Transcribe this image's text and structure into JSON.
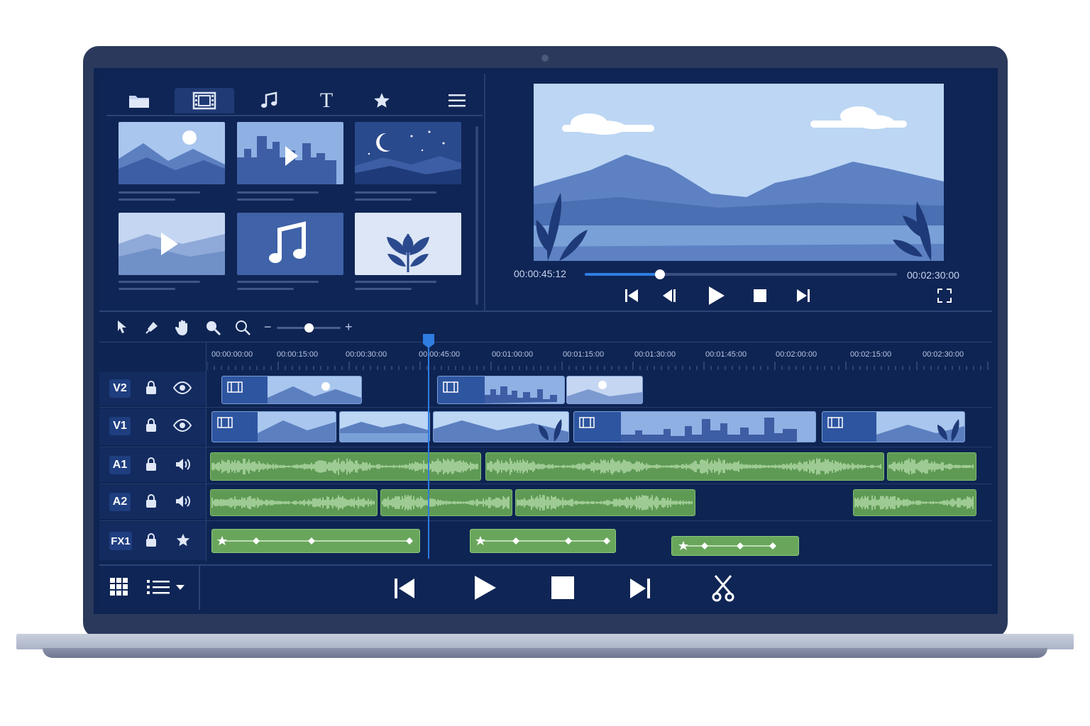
{
  "colors": {
    "screen": "#0e2452",
    "accent": "#2f7de1",
    "clip": "#4f74b5",
    "audio": "#5f9a55",
    "fx": "#69a65c"
  },
  "media_tabs": [
    {
      "icon": "folder-icon",
      "active": false
    },
    {
      "icon": "film-icon",
      "active": true
    },
    {
      "icon": "music-note-icon",
      "active": false
    },
    {
      "icon": "text-icon",
      "active": false,
      "glyph": "T"
    },
    {
      "icon": "star-icon",
      "active": false
    }
  ],
  "media_items": [
    {
      "icon": "landscape-sun-thumbnail"
    },
    {
      "icon": "city-video-thumbnail"
    },
    {
      "icon": "night-moon-thumbnail"
    },
    {
      "icon": "hills-video-thumbnail"
    },
    {
      "icon": "music-thumbnail"
    },
    {
      "icon": "leaf-thumbnail"
    }
  ],
  "preview": {
    "current_time": "00:00:45:12",
    "total_time": "00:02:30:00",
    "progress": 0.24
  },
  "timeline": {
    "zoom_level": 0.5,
    "ruler": [
      "00:00:00:00",
      "00:00:15:00",
      "00:00:30:00",
      "00:00:45:00",
      "00:01:00:00",
      "00:01:15:00",
      "00:01:30:00",
      "00:01:45:00",
      "00:02:00:00",
      "00:02:15:00",
      "00:02:30:00"
    ],
    "playhead_time": "00:00:45:12",
    "tracks": [
      {
        "label": "V2",
        "type": "video"
      },
      {
        "label": "V1",
        "type": "video"
      },
      {
        "label": "A1",
        "type": "audio"
      },
      {
        "label": "A2",
        "type": "audio"
      },
      {
        "label": "FX1",
        "type": "fx"
      }
    ]
  }
}
